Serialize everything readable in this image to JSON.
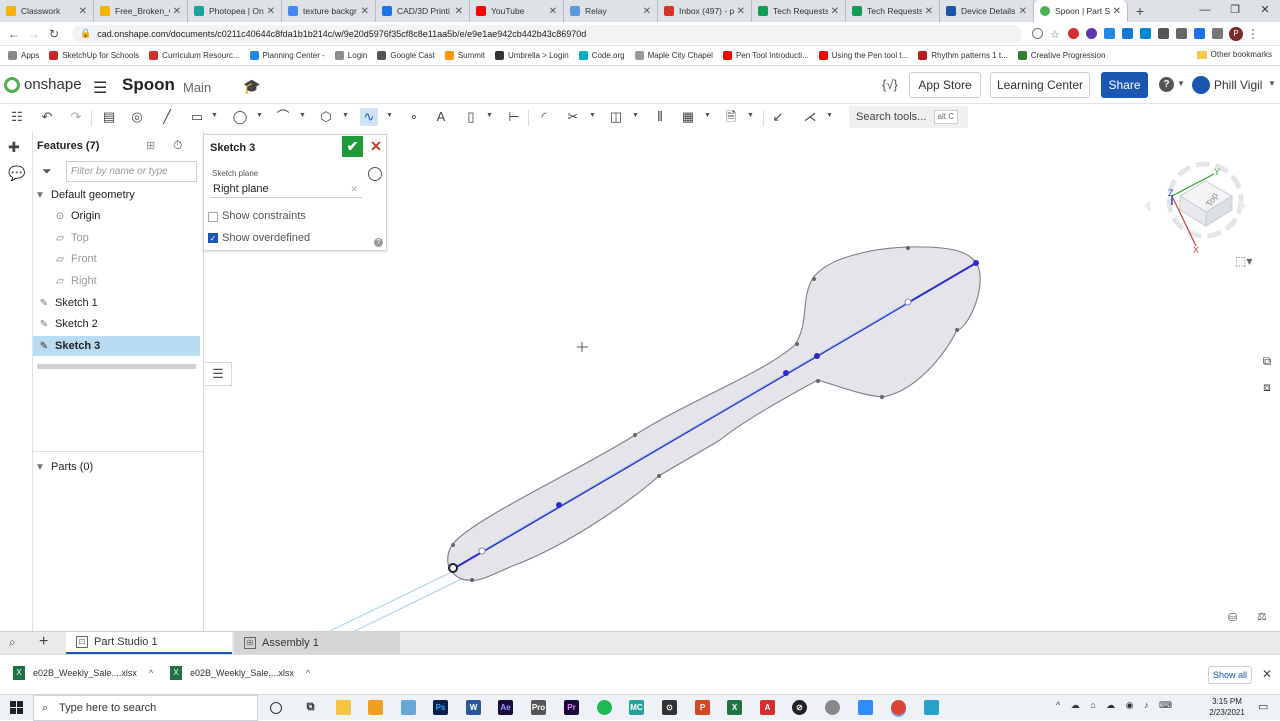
{
  "browser": {
    "tabs": [
      {
        "label": "Classwork",
        "color": "#f4b400"
      },
      {
        "label": "Free_Broken_C",
        "color": "#f4b400"
      },
      {
        "label": "Photopea | On",
        "color": "#18a497"
      },
      {
        "label": "texture backgr",
        "color": "#4285f4"
      },
      {
        "label": "CAD/3D Printi",
        "color": "#1a73e8"
      },
      {
        "label": "YouTube",
        "color": "#ff0000"
      },
      {
        "label": "Relay",
        "color": "#5b9bd5"
      },
      {
        "label": "Inbox (497) - p",
        "color": "#d93025"
      },
      {
        "label": "Tech Requests",
        "color": "#0f9d58"
      },
      {
        "label": "Tech Requests",
        "color": "#0f9d58"
      },
      {
        "label": "Device Details",
        "color": "#1a56a8"
      },
      {
        "label": "Spoon | Part St",
        "color": "#4caf50"
      }
    ],
    "new_tab": "+",
    "url": "cad.onshape.com/documents/c0211c40644c8fda1b1b214c/w/9e20d5976f35cf8c8e11aa5b/e/e9e1ae942cb442b43c86970d",
    "bookmarks": [
      {
        "label": "Apps",
        "color": "#888888"
      },
      {
        "label": "SketchUp for Schools",
        "color": "#c62828"
      },
      {
        "label": "Curriculum Resourc...",
        "color": "#d32f2f"
      },
      {
        "label": "Planning Center -",
        "color": "#1e88e5"
      },
      {
        "label": "Login",
        "color": "#8e8e8e"
      },
      {
        "label": "Google Cast",
        "color": "#555555"
      },
      {
        "label": "Summit",
        "color": "#ff9800"
      },
      {
        "label": "Umbrella > Login",
        "color": "#333333"
      },
      {
        "label": "Code.org",
        "color": "#00adbc"
      },
      {
        "label": "Maple City Chapel",
        "color": "#999999"
      },
      {
        "label": "Pen Tool Introducti...",
        "color": "#ff0000"
      },
      {
        "label": "Using the Pen tool t...",
        "color": "#ff0000"
      },
      {
        "label": "Rhythm patterns 1 t...",
        "color": "#b71c1c"
      },
      {
        "label": "Creative Progression",
        "color": "#2e7d32"
      }
    ],
    "other_bookmarks": "Other bookmarks",
    "profile_initial": "P"
  },
  "app": {
    "logo": "onshape",
    "doc_title": "Spoon",
    "doc_subtitle": "Main",
    "app_store": "App Store",
    "learning_center": "Learning Center",
    "share": "Share",
    "help": "?",
    "user_name": "Phill Vigil",
    "search_tools": "Search tools...",
    "search_shortcut": "alt C"
  },
  "features": {
    "title": "Features (7)",
    "filter_placeholder": "Filter by name or type",
    "default_geometry": "Default geometry",
    "items": [
      {
        "label": "Origin"
      },
      {
        "label": "Top"
      },
      {
        "label": "Front"
      },
      {
        "label": "Right"
      },
      {
        "label": "Sketch 1"
      },
      {
        "label": "Sketch 2"
      },
      {
        "label": "Sketch 3"
      }
    ],
    "parts": "Parts (0)"
  },
  "sketch_dialog": {
    "title": "Sketch 3",
    "plane_label": "Sketch plane",
    "plane_value": "Right plane",
    "show_constraints": "Show constraints",
    "show_constraints_checked": false,
    "show_overdefined": "Show overdefined",
    "show_overdefined_checked": true
  },
  "view_cube": {
    "face_label": "Top",
    "axis_x": "X",
    "axis_y": "Y",
    "axis_z": "Z"
  },
  "bottom_tabs": [
    {
      "label": "Part Studio 1",
      "active": true
    },
    {
      "label": "Assembly 1",
      "active": false
    }
  ],
  "downloads": [
    {
      "label": "e02B_Weekly_Sale....xlsx"
    },
    {
      "label": "e02B_Weekly_Sale....xlsx"
    }
  ],
  "show_all": "Show all",
  "taskbar": {
    "search_placeholder": "Type here to search",
    "time": "3:15 PM",
    "date": "2/23/2021"
  },
  "colors": {
    "accent": "#1b56b3",
    "sketch_line": "#2a2ad0",
    "sketch_fill": "#e4e4ea",
    "selection": "#b9dcf3"
  }
}
